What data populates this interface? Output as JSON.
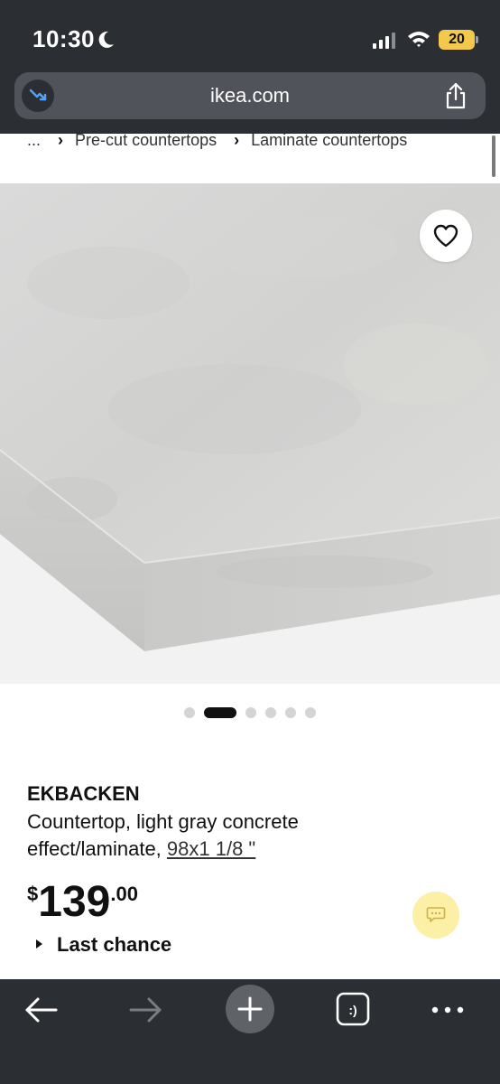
{
  "status_bar": {
    "time": "10:30",
    "battery_level": "20",
    "icons": [
      "moon-icon",
      "signal-icon",
      "wifi-icon",
      "battery-icon"
    ]
  },
  "browser": {
    "url": "ikea.com",
    "left_icon": "trend-down-icon",
    "share_icon": "share-icon"
  },
  "breadcrumb": {
    "items": [
      "...",
      "Pre-cut countertops",
      "Laminate countertops"
    ]
  },
  "product": {
    "image_alt_icon": "countertop-image",
    "favorite_icon": "heart-icon",
    "carousel": {
      "count": 6,
      "active_index": 1
    },
    "name": "EKBACKEN",
    "description": "Countertop, light gray concrete effect/laminate,",
    "size": "98x1 1/8 \"",
    "price": {
      "currency": "$",
      "integer": "139",
      "decimal": ".00"
    },
    "badge": "Last chance",
    "chat_icon": "chat-icon"
  },
  "toolbar": {
    "items": [
      "back-arrow-icon",
      "forward-arrow-icon",
      "plus-icon",
      "tabs-icon",
      "more-icon"
    ],
    "tabs_label": ":)"
  },
  "colors": {
    "chrome_dark": "#2b2e33",
    "url_bar": "#50545a",
    "battery": "#f2c94c",
    "chat_bubble": "#fbf0a6"
  }
}
